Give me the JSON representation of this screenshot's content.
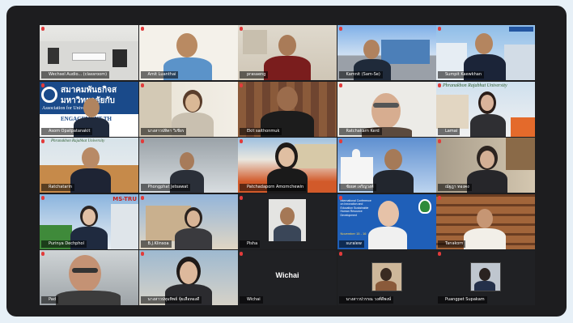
{
  "participants": [
    {
      "name": "Wechsel Audio... (classroom)"
    },
    {
      "name": "Amit Luanthai"
    },
    {
      "name": "prasaeng"
    },
    {
      "name": "Kamnit (Sam-Se)"
    },
    {
      "name": "Sumpit Kaewkhan"
    },
    {
      "name": "Asom Opatpatanakit",
      "banner_line1": "สมาคมพันธกิจส",
      "banner_line2": "มหาวิทยาลัยกับ",
      "banner_line3": "Association for Univer",
      "banner_line4": "ENGAGEMENT TH"
    },
    {
      "name": "นางสาวปทิตา วิเชียร"
    },
    {
      "name": "Ekit saithonmuk"
    },
    {
      "name": "Ratchakarn Kerd"
    },
    {
      "name": "Lamai"
    },
    {
      "name": "Ratchatarin"
    },
    {
      "name": "Phongphat Jetsawat"
    },
    {
      "name": "Patchadaporn Amornchewin"
    },
    {
      "name": "ชัยยศ เจริญวงศ์"
    },
    {
      "name": "ณัฐฎา ทองคง"
    },
    {
      "name": "Purinya Dechphol",
      "banner": "MS-TRU"
    },
    {
      "name": "B.J.Klinsoa"
    },
    {
      "name": "Pisha"
    },
    {
      "name": "suraiew",
      "conf_text": "International Conference on Innovation and Education Sustainable Human Resource Development",
      "conf_date": "November 15 - 16"
    },
    {
      "name": "Tanakorn"
    },
    {
      "name": "Pad"
    },
    {
      "name": "นางสาวปทุมทิพย์ จุ้ยเสือทองดี"
    },
    {
      "name": "Wichai",
      "display": "Wichai"
    },
    {
      "name": "นางสาวปวรรณ วงศ์ดีพงษ์"
    },
    {
      "name": "Puangpet Supakam"
    }
  ],
  "banner_uni": "Phranakhon Rajabhat University",
  "colors": {
    "window": "#1d1d1f",
    "page_bg": "#e7f0f7",
    "mic_muted": "#e23b3b"
  }
}
